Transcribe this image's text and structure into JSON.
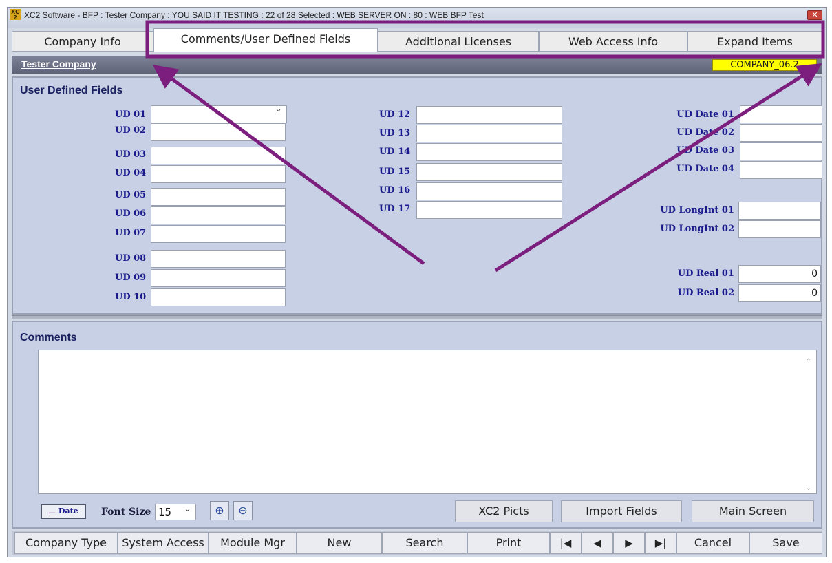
{
  "window": {
    "title": "XC2 Software - BFP : Tester Company : YOU SAID IT TESTING : 22 of 28 Selected : WEB SERVER ON : 80 : WEB BFP Test",
    "icon": "xc2-app-icon",
    "close_label": "✕"
  },
  "tabs": [
    {
      "label": "Company Info"
    },
    {
      "label": "Comments/User Defined Fields",
      "active": true
    },
    {
      "label": "Additional Licenses"
    },
    {
      "label": "Web Access Info"
    },
    {
      "label": "Expand Items"
    }
  ],
  "header": {
    "company_name": "Tester Company",
    "screen_code": "COMPANY_06.2"
  },
  "udf": {
    "title": "User Defined Fields",
    "col1": [
      {
        "label": "UD 01",
        "value": ""
      },
      {
        "label": "UD 02",
        "value": ""
      },
      {
        "label": "UD 03",
        "value": ""
      },
      {
        "label": "UD 04",
        "value": ""
      },
      {
        "label": "UD 05",
        "value": ""
      },
      {
        "label": "UD 06",
        "value": ""
      },
      {
        "label": "UD 07",
        "value": ""
      },
      {
        "label": "UD 08",
        "value": ""
      },
      {
        "label": "UD 09",
        "value": ""
      },
      {
        "label": "UD 10",
        "value": ""
      }
    ],
    "col2": [
      {
        "label": "UD 12",
        "value": ""
      },
      {
        "label": "UD 13",
        "value": ""
      },
      {
        "label": "UD 14",
        "value": ""
      },
      {
        "label": "UD 15",
        "value": ""
      },
      {
        "label": "UD 16",
        "value": ""
      },
      {
        "label": "UD 17",
        "value": ""
      }
    ],
    "dates": [
      {
        "label": "UD Date 01",
        "value": ""
      },
      {
        "label": "UD Date 02",
        "value": ""
      },
      {
        "label": "UD Date 03",
        "value": ""
      },
      {
        "label": "UD Date 04",
        "value": ""
      }
    ],
    "longints": [
      {
        "label": "UD LongInt 01",
        "value": ""
      },
      {
        "label": "UD LongInt 02",
        "value": ""
      }
    ],
    "reals": [
      {
        "label": "UD Real 01",
        "value": "0"
      },
      {
        "label": "UD Real 02",
        "value": "0"
      }
    ]
  },
  "comments": {
    "title": "Comments",
    "text": "",
    "date_button": "Date",
    "font_size_label": "Font Size",
    "font_size_value": "15",
    "zoom_in_icon": "zoom-in-icon",
    "zoom_out_icon": "zoom-out-icon",
    "buttons": [
      "XC2 Picts",
      "Import Fields",
      "Main Screen"
    ]
  },
  "toolbar": {
    "buttons": [
      "Company Type",
      "System Access",
      "Module Mgr",
      "New",
      "Search",
      "Print"
    ],
    "nav": [
      "|◀",
      "◀",
      "▶",
      "▶|"
    ],
    "cancel": "Cancel",
    "save": "Save"
  },
  "colors": {
    "annotation": "#7b1e7d",
    "panel": "#c7d0e5",
    "label": "#1a1a8c",
    "screen_code_bg": "#ffff00"
  }
}
